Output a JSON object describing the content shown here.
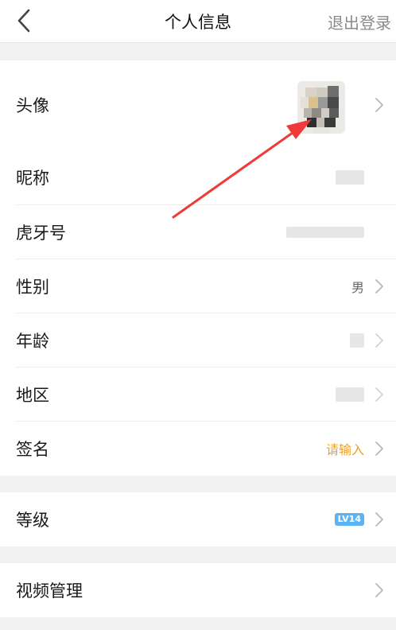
{
  "header": {
    "title": "个人信息",
    "logout_label": "退出登录"
  },
  "profile": {
    "avatar_label": "头像",
    "nickname_label": "昵称",
    "huya_id_label": "虎牙号",
    "gender_label": "性别",
    "gender_value": "男",
    "age_label": "年龄",
    "region_label": "地区",
    "signature_label": "签名",
    "signature_placeholder": "请输入"
  },
  "level": {
    "label": "等级",
    "badge": "LV14"
  },
  "video": {
    "label": "视频管理"
  },
  "colors": {
    "accent_placeholder": "#f0a020",
    "level_badge": "#5cb4f5",
    "annotation_arrow": "#f03a3a"
  }
}
